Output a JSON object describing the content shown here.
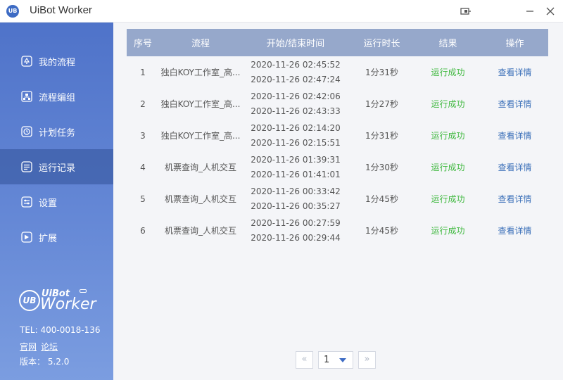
{
  "app": {
    "title": "UiBot Worker",
    "logo_text": "UB"
  },
  "sidebar": {
    "items": [
      {
        "label": "我的流程",
        "icon": "recycle-icon"
      },
      {
        "label": "流程编组",
        "icon": "sitemap-icon"
      },
      {
        "label": "计划任务",
        "icon": "clock-icon"
      },
      {
        "label": "运行记录",
        "icon": "document-list-icon",
        "active": true
      },
      {
        "label": "设置",
        "icon": "settings-sliders-icon"
      },
      {
        "label": "扩展",
        "icon": "extension-arrow-icon"
      }
    ],
    "brand": {
      "mark": "UB",
      "top": "UiBot",
      "bottom": "Worker"
    },
    "tel": "TEL: 400-0018-136",
    "link_official": "官网",
    "link_forum": "论坛",
    "version": "版本： 5.2.0"
  },
  "table": {
    "headers": [
      "序号",
      "流程",
      "开始/结束时间",
      "运行时长",
      "结果",
      "操作"
    ],
    "rows": [
      {
        "index": "1",
        "flow": "独白KOY工作室_高...",
        "start": "2020-11-26 02:45:52",
        "end": "2020-11-26 02:47:24",
        "duration": "1分31秒",
        "result": "运行成功",
        "action": "查看详情"
      },
      {
        "index": "2",
        "flow": "独白KOY工作室_高...",
        "start": "2020-11-26 02:42:06",
        "end": "2020-11-26 02:43:33",
        "duration": "1分27秒",
        "result": "运行成功",
        "action": "查看详情"
      },
      {
        "index": "3",
        "flow": "独白KOY工作室_高...",
        "start": "2020-11-26 02:14:20",
        "end": "2020-11-26 02:15:51",
        "duration": "1分31秒",
        "result": "运行成功",
        "action": "查看详情"
      },
      {
        "index": "4",
        "flow": "机票查询_人机交互",
        "start": "2020-11-26 01:39:31",
        "end": "2020-11-26 01:41:01",
        "duration": "1分30秒",
        "result": "运行成功",
        "action": "查看详情"
      },
      {
        "index": "5",
        "flow": "机票查询_人机交互",
        "start": "2020-11-26 00:33:42",
        "end": "2020-11-26 00:35:27",
        "duration": "1分45秒",
        "result": "运行成功",
        "action": "查看详情"
      },
      {
        "index": "6",
        "flow": "机票查询_人机交互",
        "start": "2020-11-26 00:27:59",
        "end": "2020-11-26 00:29:44",
        "duration": "1分45秒",
        "result": "运行成功",
        "action": "查看详情"
      }
    ]
  },
  "pager": {
    "prev": "«",
    "page": "1",
    "next": "»"
  },
  "colors": {
    "accent": "#3d6bc4",
    "sidebar": "#5a7fd0",
    "header": "#96a8cb",
    "success": "#41b941",
    "link": "#3a6fb8"
  }
}
